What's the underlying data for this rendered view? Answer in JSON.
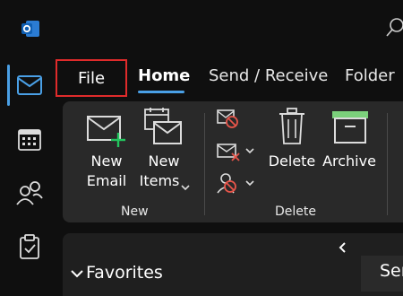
{
  "app": {
    "icon": "outlook-logo-icon"
  },
  "search": {
    "icon": "search-icon"
  },
  "rail": {
    "items": [
      {
        "name": "mail",
        "icon": "mail-icon",
        "active": true
      },
      {
        "name": "calendar",
        "icon": "calendar-icon",
        "active": false
      },
      {
        "name": "people",
        "icon": "people-icon",
        "active": false
      },
      {
        "name": "tasks",
        "icon": "tasks-icon",
        "active": false
      }
    ]
  },
  "tabs": {
    "file": "File",
    "home": "Home",
    "send_receive": "Send / Receive",
    "folder": "Folder"
  },
  "ribbon": {
    "new_group": {
      "label": "New",
      "new_email": {
        "line1": "New",
        "line2": "Email"
      },
      "new_items": {
        "line1": "New",
        "line2": "Items"
      }
    },
    "delete_group": {
      "label": "Delete",
      "delete": "Delete",
      "archive": "Archive"
    }
  },
  "folder_pane": {
    "favorites": "Favorites",
    "collapse_icon": "chevron-left-icon"
  },
  "message_list": {
    "header_partial": "Ser"
  },
  "colors": {
    "accent": "#4aa0e6",
    "highlight_box": "#e02b2b",
    "archive_green": "#7bd17b",
    "new_green": "#22c55e"
  }
}
